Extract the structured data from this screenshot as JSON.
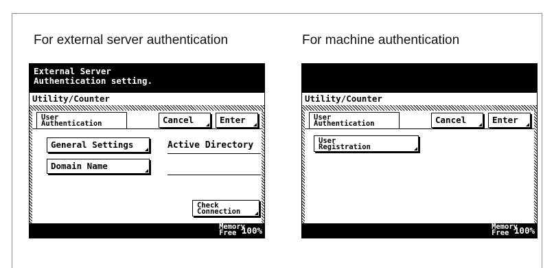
{
  "left_caption": "For external server authentication",
  "right_caption": "For machine authentication",
  "left_screen": {
    "message_line1": "External Server",
    "message_line2": "Authentication setting.",
    "breadcrumb": "Utility/Counter",
    "tab_line1": "User",
    "tab_line2": "Authentication",
    "cancel_label": "Cancel",
    "enter_label": "Enter",
    "general_settings_label": "General Settings",
    "general_settings_value": "Active Directory",
    "domain_name_label": "Domain Name",
    "domain_name_value": "",
    "check_line1": "Check",
    "check_line2": "Connection",
    "memory_line1": "Memory",
    "memory_line2": "Free",
    "memory_value": "100%"
  },
  "right_screen": {
    "breadcrumb": "Utility/Counter",
    "tab_line1": "User",
    "tab_line2": "Authentication",
    "cancel_label": "Cancel",
    "enter_label": "Enter",
    "registration_line1": "User",
    "registration_line2": "Registration",
    "memory_line1": "Memory",
    "memory_line2": "Free",
    "memory_value": "100%"
  }
}
